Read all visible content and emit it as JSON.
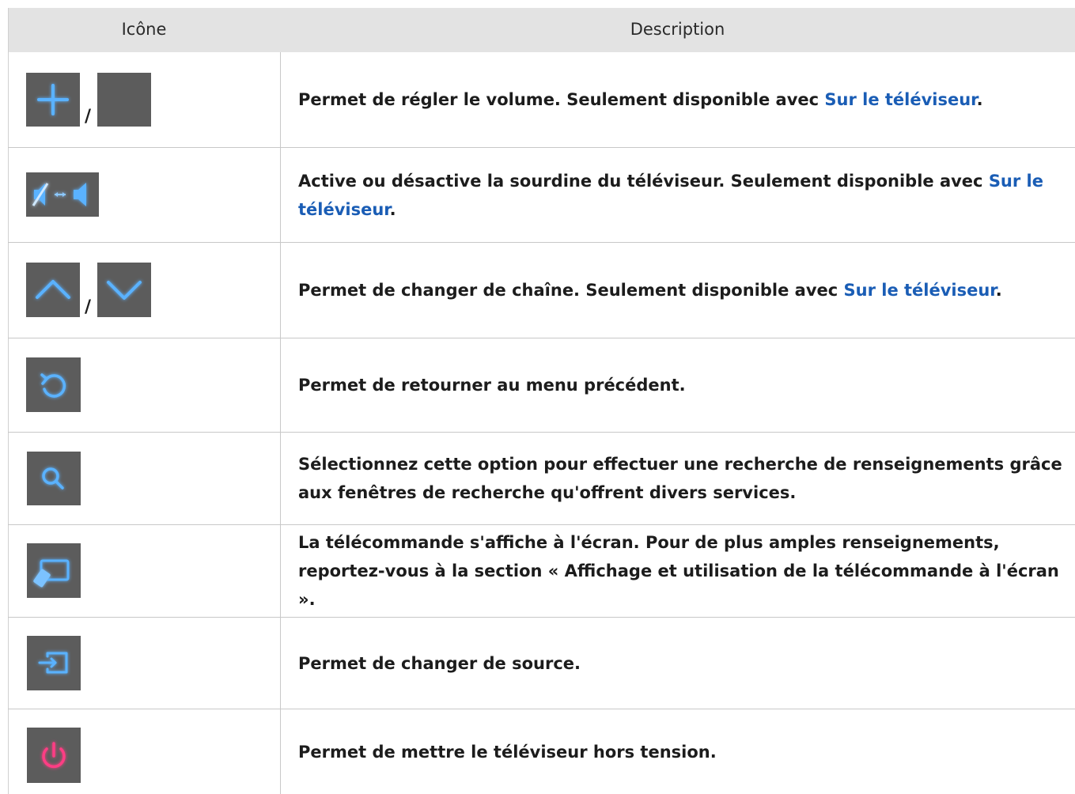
{
  "header": {
    "col_icon": "Icône",
    "col_description": "Description"
  },
  "separator": "/",
  "rows": [
    {
      "icons": [
        "plus-icon",
        "minus-icon"
      ],
      "text": "Permet de régler le volume. Seulement disponible avec ",
      "link": "Sur le téléviseur",
      "end": "."
    },
    {
      "icons": [
        "mute-toggle-icon"
      ],
      "text": "Active ou désactive la sourdine du téléviseur. Seulement disponible avec ",
      "link": "Sur le téléviseur",
      "end": "."
    },
    {
      "icons": [
        "chevron-up-icon",
        "chevron-down-icon"
      ],
      "text": "Permet de changer de chaîne. Seulement disponible avec ",
      "link": "Sur le téléviseur",
      "end": "."
    },
    {
      "icons": [
        "return-icon"
      ],
      "text": "Permet de retourner au menu précédent."
    },
    {
      "icons": [
        "search-icon"
      ],
      "text": "Sélectionnez cette option pour effectuer une recherche de renseignements grâce aux fenêtres de recherche qu'offrent divers services."
    },
    {
      "icons": [
        "remote-control-icon"
      ],
      "text": "La télécommande s'affiche à l'écran. Pour de plus amples renseignements, reportez-vous à la section « Affichage et utilisation de la télécommande à l'écran »."
    },
    {
      "icons": [
        "source-icon"
      ],
      "text": "Permet de changer de source."
    },
    {
      "icons": [
        "power-icon"
      ],
      "text": "Permet de mettre le téléviseur hors tension."
    }
  ],
  "colors": {
    "header_bg": "#e3e3e3",
    "icon_bg": "#5c5c5c",
    "icon_glyph": "#3aa0ff",
    "power_glyph": "#ff2f7a",
    "link": "#1a5db5",
    "grid": "#c8c8c8"
  }
}
